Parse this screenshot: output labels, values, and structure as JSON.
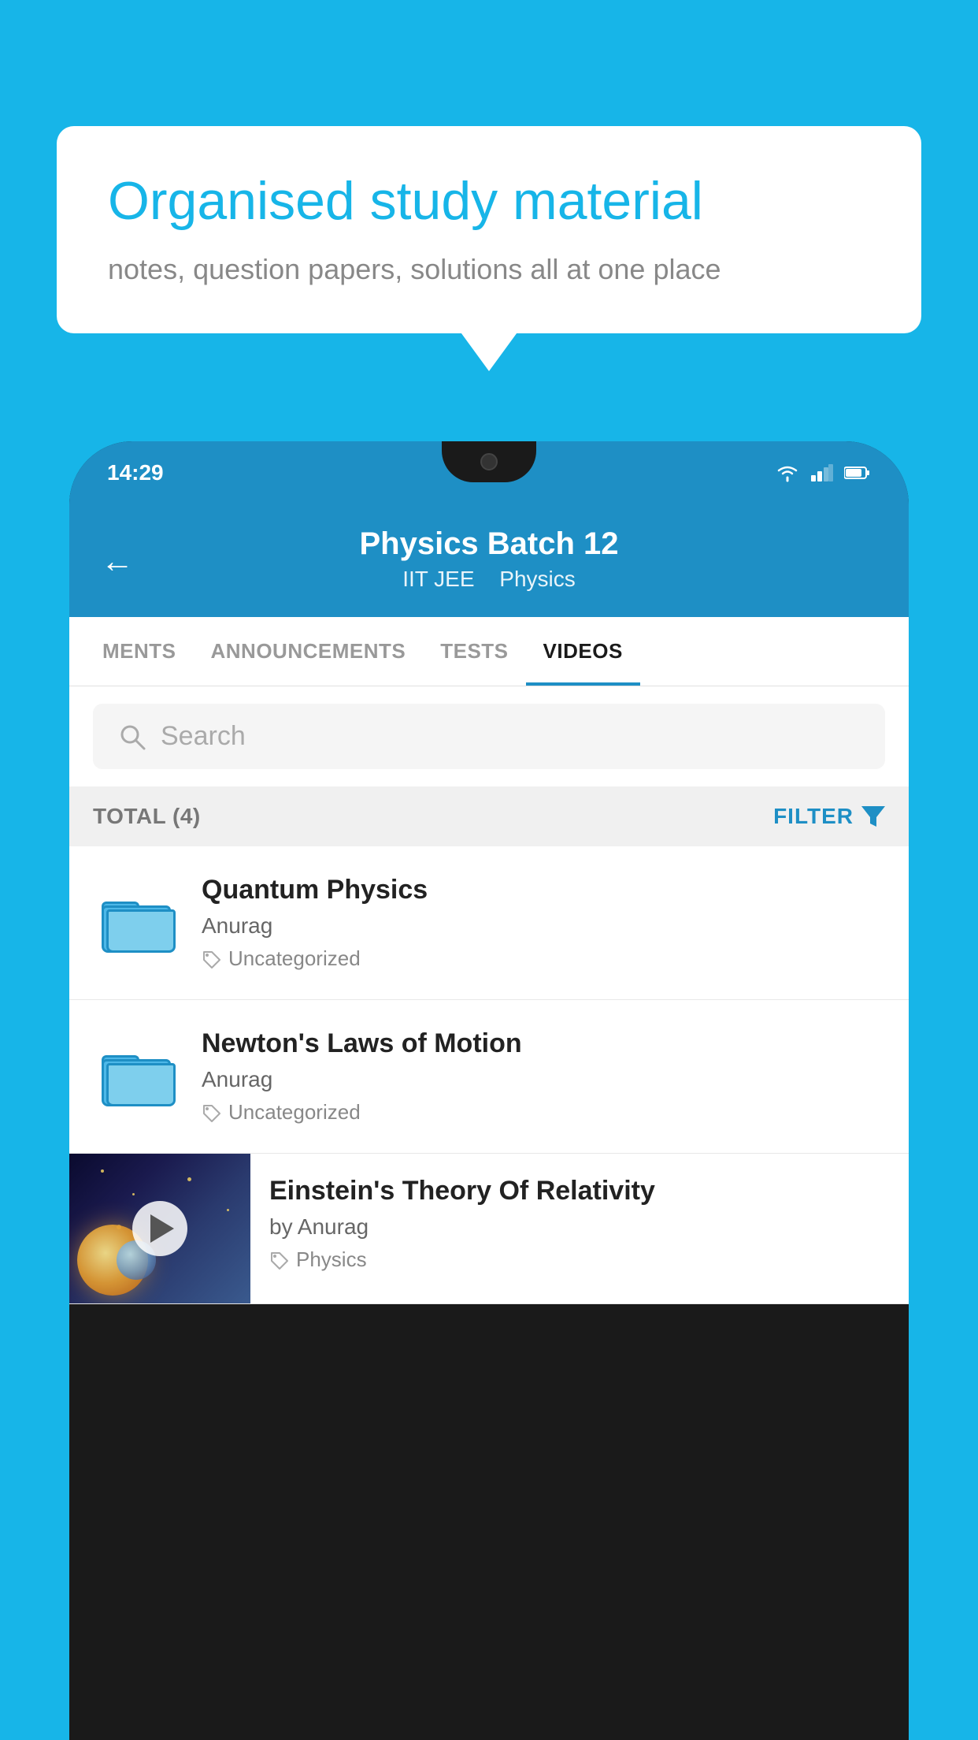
{
  "background": {
    "color": "#17b5e8"
  },
  "speech_bubble": {
    "title": "Organised study material",
    "subtitle": "notes, question papers, solutions all at one place"
  },
  "phone": {
    "status_bar": {
      "time": "14:29"
    },
    "app_header": {
      "back_label": "←",
      "title": "Physics Batch 12",
      "subtitle_part1": "IIT JEE",
      "subtitle_part2": "Physics"
    },
    "tabs": [
      {
        "label": "MENTS",
        "active": false
      },
      {
        "label": "ANNOUNCEMENTS",
        "active": false
      },
      {
        "label": "TESTS",
        "active": false
      },
      {
        "label": "VIDEOS",
        "active": true
      }
    ],
    "search": {
      "placeholder": "Search"
    },
    "filter_bar": {
      "total_label": "TOTAL (4)",
      "filter_label": "FILTER"
    },
    "video_items": [
      {
        "id": 1,
        "title": "Quantum Physics",
        "author": "Anurag",
        "tag": "Uncategorized",
        "has_thumbnail": false
      },
      {
        "id": 2,
        "title": "Newton's Laws of Motion",
        "author": "Anurag",
        "tag": "Uncategorized",
        "has_thumbnail": false
      },
      {
        "id": 3,
        "title": "Einstein's Theory Of Relativity",
        "author": "by Anurag",
        "tag": "Physics",
        "has_thumbnail": true
      }
    ]
  }
}
